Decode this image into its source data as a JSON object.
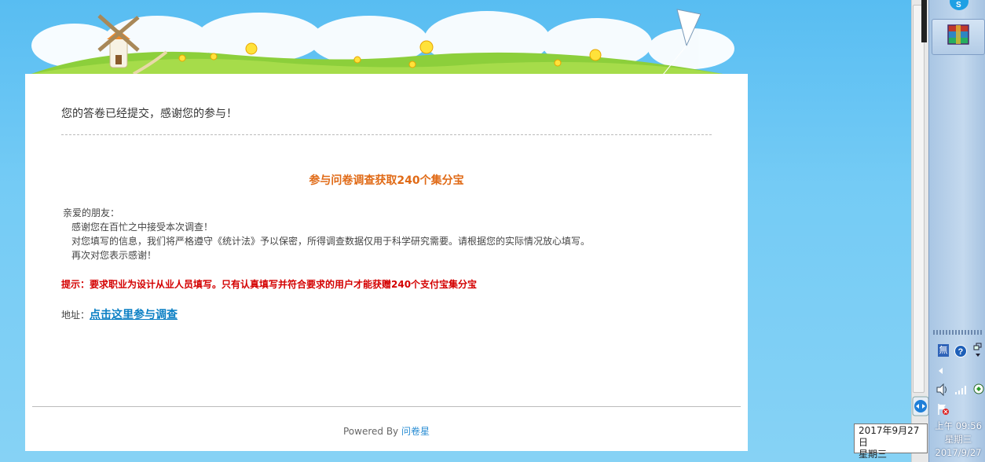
{
  "page": {
    "message": "您的答卷已经提交，感谢您的参与！",
    "title": "参与问卷调查获取240个集分宝",
    "body_lines": [
      "亲爱的朋友：",
      "感谢您在百忙之中接受本次调查！",
      "对您填写的信息，我们将严格遵守《统计法》予以保密，所得调查数据仅用于科学研究需要。请根据您的实际情况放心填写。",
      "再次对您表示感谢！"
    ],
    "tip": "提示：要求职业为设计从业人员填写。只有认真填写并符合要求的用户才能获赠240个支付宝集分宝",
    "address_label": "地址：",
    "address_link": "点击这里参与调查",
    "powered_by": "Powered By",
    "powered_brand": "问卷星"
  },
  "taskbar": {
    "ime_label": "無",
    "clock_time": "上午 09:56",
    "clock_day": "星期三",
    "clock_date": "2017/9/27",
    "tooltip_date": "2017年9月27日",
    "tooltip_day": "星期三"
  },
  "colors": {
    "title": "#e06a16",
    "tip": "#d40000",
    "link": "#0a7fc4"
  }
}
